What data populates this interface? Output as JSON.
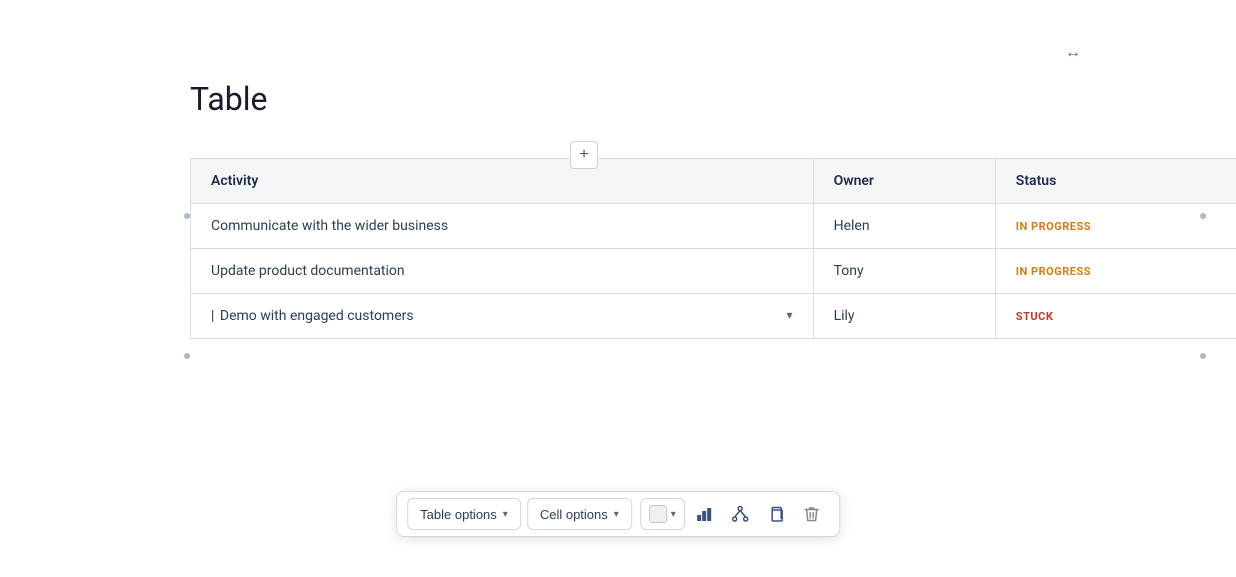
{
  "page": {
    "title": "Table",
    "resize_icon": "↔"
  },
  "table": {
    "columns": [
      {
        "key": "activity",
        "label": "Activity"
      },
      {
        "key": "owner",
        "label": "Owner"
      },
      {
        "key": "status",
        "label": "Status"
      }
    ],
    "rows": [
      {
        "activity": "Communicate with the wider business",
        "owner": "Helen",
        "status": "IN PROGRESS",
        "status_type": "inprogress"
      },
      {
        "activity": "Update product documentation",
        "owner": "Tony",
        "status": "IN PROGRESS",
        "status_type": "inprogress"
      },
      {
        "activity": "Demo with engaged customers",
        "owner": "Lily",
        "status": "STUCK",
        "status_type": "stuck"
      }
    ]
  },
  "toolbar": {
    "table_options_label": "Table options",
    "cell_options_label": "Cell options",
    "chevron_icon": "▾",
    "bar_chart_icon": "📊",
    "network_icon": "🔗",
    "copy_icon": "⧉",
    "delete_icon": "🗑"
  },
  "add_column": {
    "label": "+"
  }
}
